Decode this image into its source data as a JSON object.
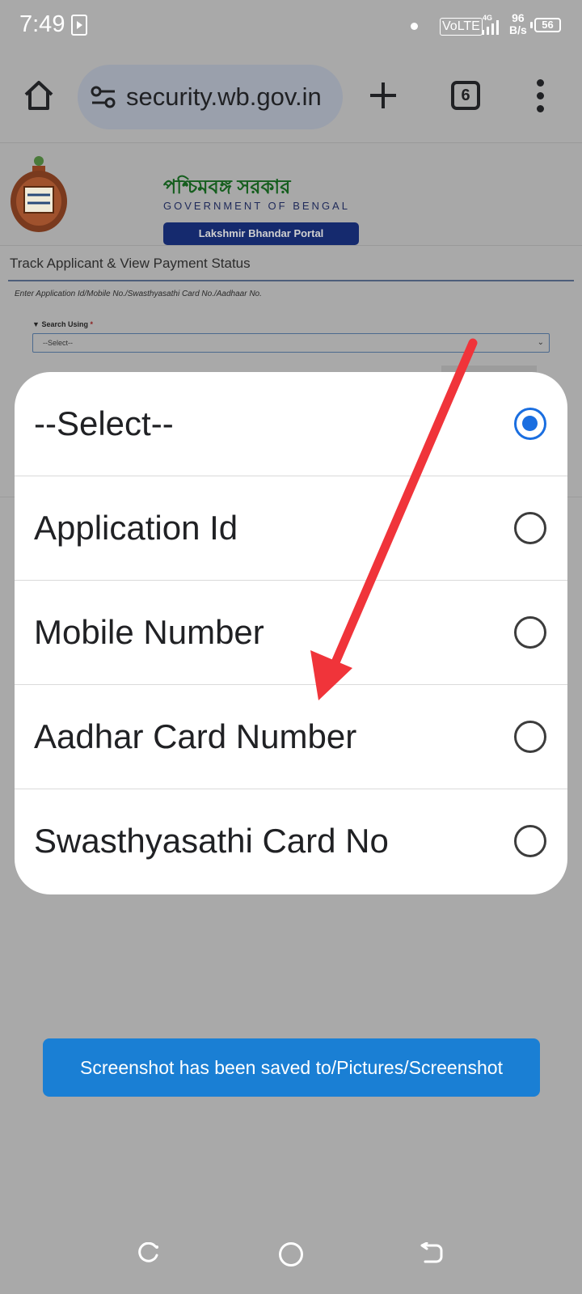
{
  "status_bar": {
    "time": "7:49",
    "volte": "VoLTE",
    "network_type": "4G",
    "net_speed_value": "96",
    "net_speed_unit": "B/s",
    "battery": "56"
  },
  "browser": {
    "url": "security.wb.gov.in",
    "tab_count": "6"
  },
  "page": {
    "gov_name_bengali": "পশ্চিমবঙ্গ সরকার",
    "gov_name_english": "GOVERNMENT OF BENGAL",
    "portal_button": "Lakshmir Bhandar Portal",
    "track_title": "Track Applicant & View Payment Status",
    "enter_hint": "Enter Application Id/Mobile No./Swasthyasathi Card No./Aadhaar No.",
    "search_label": "Search Using",
    "search_required": "*",
    "search_select_value": "--Select--"
  },
  "dialog": {
    "options": [
      {
        "label": "--Select--",
        "selected": true
      },
      {
        "label": "Application Id",
        "selected": false
      },
      {
        "label": "Mobile Number",
        "selected": false
      },
      {
        "label": "Aadhar Card Number",
        "selected": false
      },
      {
        "label": "Swasthyasathi Card No",
        "selected": false
      }
    ]
  },
  "toast": {
    "message": "Screenshot has been saved to/Pictures/Screenshot"
  },
  "colors": {
    "accent": "#1a6ee0",
    "toast": "#1a7fd4",
    "annotation_arrow": "#f0343a",
    "portal_button": "#152a6e"
  }
}
